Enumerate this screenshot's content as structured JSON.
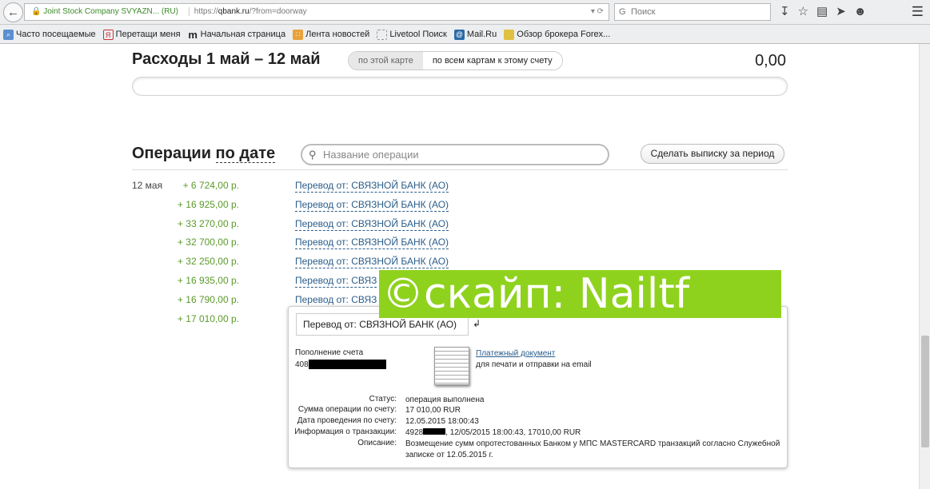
{
  "browser": {
    "site_identity": "Joint Stock Company SVYAZN... (RU)",
    "url_prefix": "https://",
    "url_domain": "qbank.ru",
    "url_rest": "/?from=doorway",
    "search_placeholder": "Поиск",
    "bookmarks": [
      "Часто посещаемые",
      "Перетащи меня",
      "Начальная страница",
      "Лента новостей",
      "Livetool Поиск",
      "Mail.Ru",
      "Обзор брокера Forex..."
    ]
  },
  "expenses": {
    "title": "Расходы 1 май – 12 май",
    "toggle_card": "по этой карте",
    "toggle_all": "по всем картам к этому счету",
    "total": "0,00"
  },
  "operations": {
    "title": "Операции",
    "sort": "по дате",
    "search_placeholder": "Название операции",
    "statement_button": "Сделать выписку за период",
    "rows": [
      {
        "date": "12 мая",
        "amount": "+ 6 724,00 р.",
        "desc": "Перевод от: СВЯЗНОЙ БАНК (АО)"
      },
      {
        "date": "",
        "amount": "+ 16 925,00 р.",
        "desc": "Перевод от: СВЯЗНОЙ БАНК (АО)"
      },
      {
        "date": "",
        "amount": "+ 33 270,00 р.",
        "desc": "Перевод от: СВЯЗНОЙ БАНК (АО)"
      },
      {
        "date": "",
        "amount": "+ 32 700,00 р.",
        "desc": "Перевод от: СВЯЗНОЙ БАНК (АО)"
      },
      {
        "date": "",
        "amount": "+ 32 250,00 р.",
        "desc": "Перевод от: СВЯЗНОЙ БАНК (АО)"
      },
      {
        "date": "",
        "amount": "+ 16 935,00 р.",
        "desc": "Перевод от: СВЯЗ"
      },
      {
        "date": "",
        "amount": "+ 16 790,00 р.",
        "desc": "Перевод от: СВЯЗ"
      },
      {
        "date": "",
        "amount": "+ 17 010,00 р.",
        "desc": ""
      }
    ]
  },
  "detail": {
    "tab": "Перевод от: СВЯЗНОЙ БАНК (АО)",
    "kind": "Пополнение счета",
    "account_prefix": "408",
    "doc_link": "Платежный документ",
    "doc_sub": "для печати и отправки на email",
    "fields": [
      {
        "k": "Статус:",
        "v": "операция выполнена"
      },
      {
        "k": "Сумма операции по счету:",
        "v": "17 010,00 RUR"
      },
      {
        "k": "Дата проведения по счету:",
        "v": "12.05.2015 18:00:43"
      },
      {
        "k": "Информация о транзакции:",
        "v_prefix": "4928",
        "v": ", 12/05/2015 18:00:43, 17010,00 RUR"
      },
      {
        "k": "Описание:",
        "v": "Возмещение сумм опротестованных Банком у МПС MASTERCARD транзакций согласно Служебной записке от 12.05.2015 г."
      }
    ]
  },
  "watermark": "©скайп: Nailtf"
}
